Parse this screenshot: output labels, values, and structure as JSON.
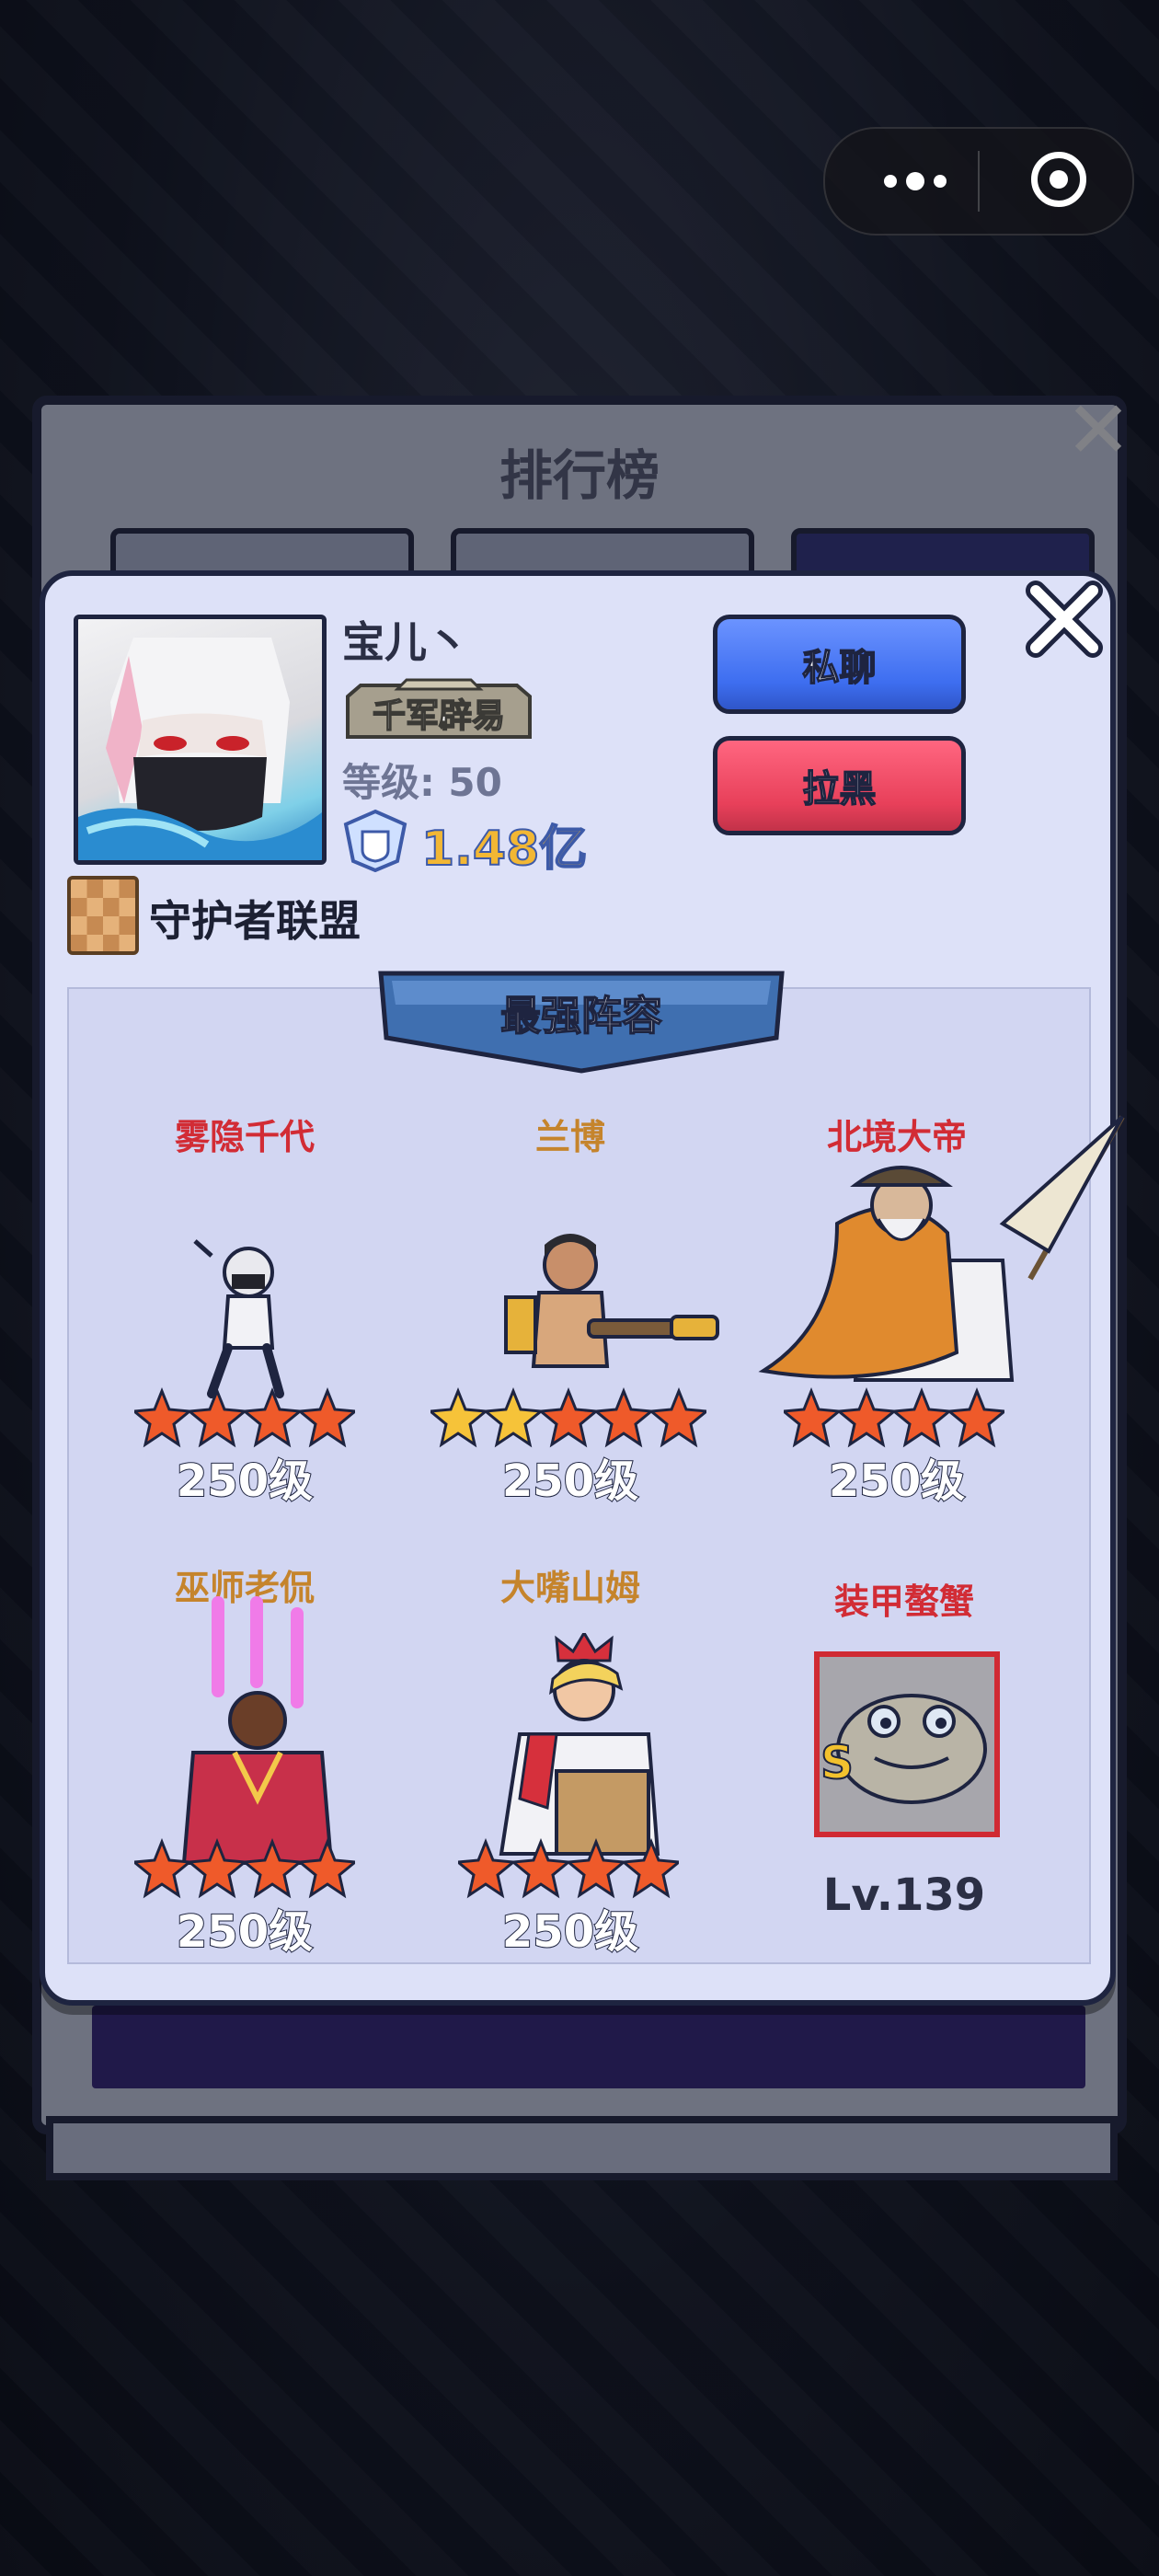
{
  "board": {
    "title": "排行榜"
  },
  "player": {
    "name": "宝儿丶",
    "title_badge": "千军辟易",
    "level": "等级: 50",
    "power": "1.48亿",
    "guild": "守护者联盟"
  },
  "actions": {
    "chat_label": "私聊",
    "block_label": "拉黑"
  },
  "lineup": {
    "title": "最强阵容",
    "heroes": [
      {
        "name": "雾隐千代",
        "name_color": "red",
        "stars": 4,
        "level": "250级"
      },
      {
        "name": "兰博",
        "name_color": "orange",
        "stars": 5,
        "gold_stars": 2,
        "level": "250级"
      },
      {
        "name": "北境大帝",
        "name_color": "red",
        "stars": 4,
        "level": "250级"
      },
      {
        "name": "巫师老侃",
        "name_color": "orange",
        "stars": 4,
        "level": "250级"
      },
      {
        "name": "大嘴山姆",
        "name_color": "orange",
        "stars": 4,
        "level": "250级"
      }
    ],
    "pet": {
      "name": "装甲螯蟹",
      "grade": "S",
      "level": "Lv.139"
    }
  },
  "colors": {
    "popup_bg": "#dde1f8",
    "outline": "#1e2440",
    "chat_button": "#4a78f5",
    "block_button": "#e8405a",
    "name_red": "#d22c35",
    "name_orange": "#c5842c",
    "power_gold": "#f2b734"
  }
}
